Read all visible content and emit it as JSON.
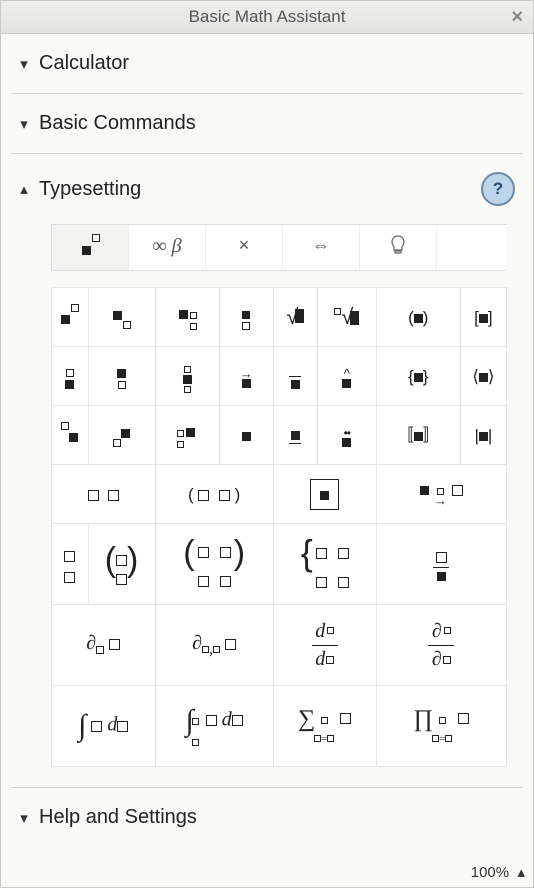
{
  "title": "Basic Math Assistant",
  "sections": {
    "calculator": {
      "label": "Calculator",
      "expanded": false
    },
    "basic_commands": {
      "label": "Basic Commands",
      "expanded": false
    },
    "typesetting": {
      "label": "Typesetting",
      "expanded": true
    },
    "help_settings": {
      "label": "Help and Settings",
      "expanded": false
    }
  },
  "help_badge": "?",
  "zoom": "100%",
  "tabs": [
    {
      "id": "templates",
      "glyph": "■□",
      "active": true
    },
    {
      "id": "symbols",
      "glyph": "∞ β",
      "active": false
    },
    {
      "id": "times",
      "glyph": "×",
      "active": false
    },
    {
      "id": "arrows",
      "glyph": "⇔",
      "active": false
    },
    {
      "id": "hints",
      "glyph": "💡",
      "active": false
    }
  ],
  "grid_row1": [
    "superscript",
    "subscript",
    "subsuperscript",
    "over-under",
    "sqrt",
    "nth-root",
    "parentheses",
    "square-brackets"
  ],
  "grid_row2": [
    "over",
    "under",
    "over-under2",
    "vector-arrow",
    "overbar",
    "hat",
    "curly-braces",
    "angle-brackets"
  ],
  "grid_row3": [
    "left-super",
    "left-sub",
    "left-subsuper",
    "underscript",
    "underbar",
    "double-dot",
    "double-square",
    "abs-bars"
  ],
  "grid_row4": [
    "two-boxes",
    "paren-two",
    "framed-box",
    "labeled-arrow"
  ],
  "grid_row5": [
    "column-pair",
    "binomial",
    "matrix-2x2",
    "piecewise",
    "fraction-box"
  ],
  "grid_row6": [
    "partial-single",
    "partial-double",
    "dd-fraction",
    "partial-fraction"
  ],
  "grid_row7": [
    "integral",
    "definite-integral",
    "sum",
    "product"
  ]
}
